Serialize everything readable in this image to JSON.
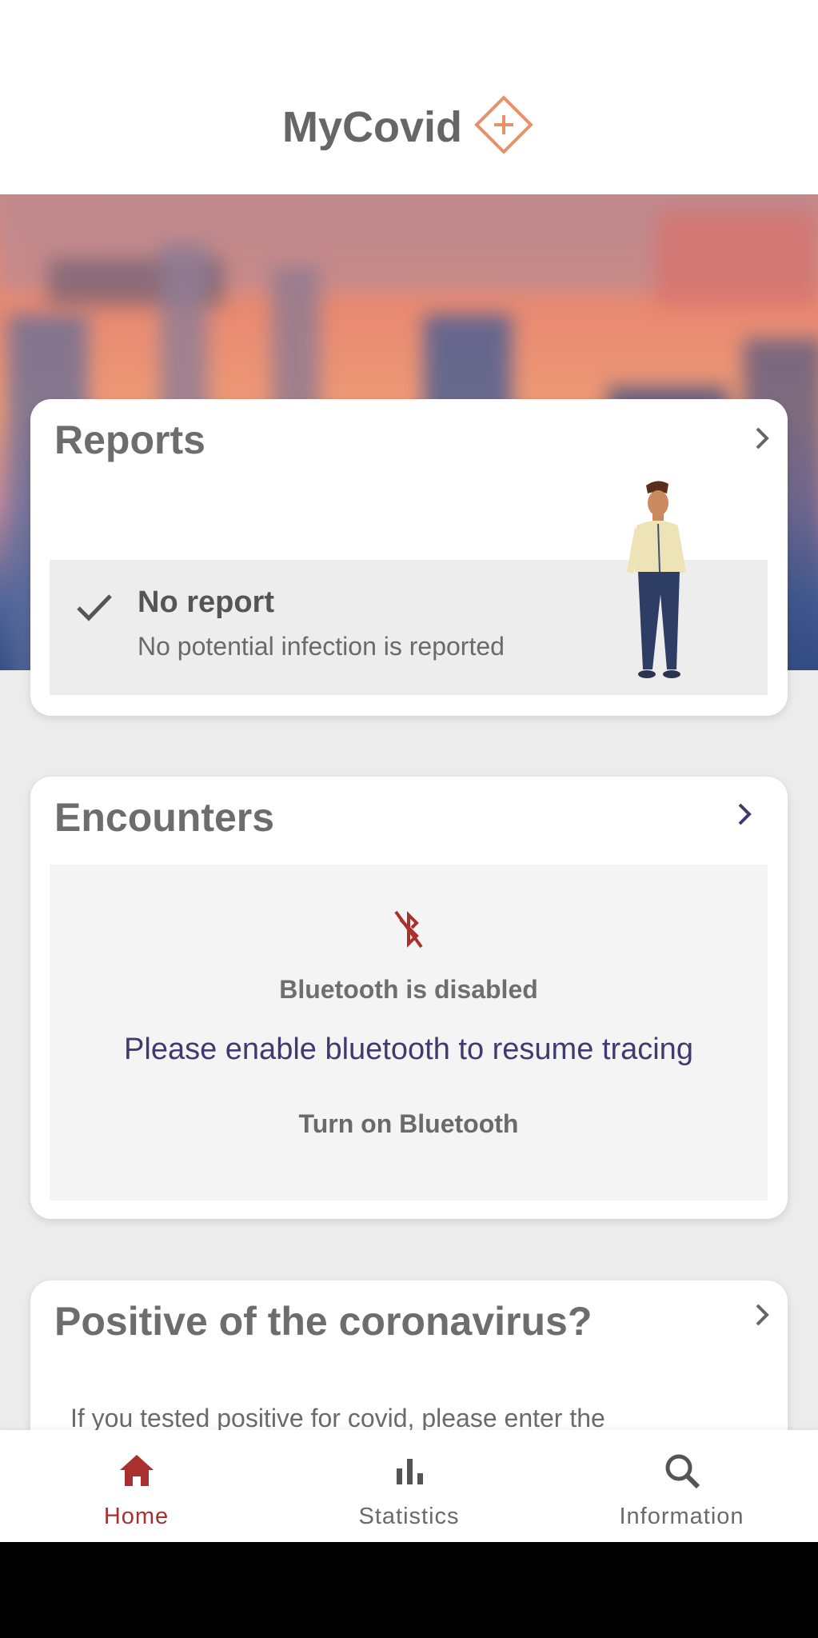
{
  "app": {
    "title": "MyCovid"
  },
  "reports": {
    "title": "Reports",
    "status_title": "No report",
    "status_subtitle": "No potential infection is reported"
  },
  "encounters": {
    "title": "Encounters",
    "bluetooth_status": "Bluetooth is disabled",
    "message": "Please enable bluetooth to resume tracing",
    "action_label": "Turn on Bluetooth"
  },
  "positive": {
    "title": "Positive of the coronavirus?",
    "body": "If you tested positive for covid, please enter the"
  },
  "nav": {
    "items": [
      {
        "label": "Home",
        "icon": "home-icon",
        "active": true
      },
      {
        "label": "Statistics",
        "icon": "bar-chart-icon",
        "active": false
      },
      {
        "label": "Information",
        "icon": "search-icon",
        "active": false
      }
    ]
  },
  "colors": {
    "accent_red": "#a8312f",
    "logo_orange": "#e8906a",
    "text_gray": "#6d6d6d",
    "message_navy": "#3f3b6e",
    "page_background": "#ececec"
  }
}
